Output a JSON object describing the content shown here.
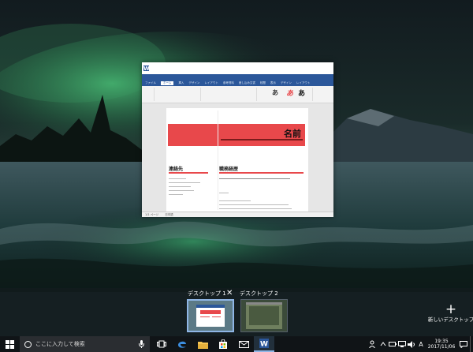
{
  "window": {
    "title": "文書 1 - Word",
    "app_icon_letter": "W",
    "ribbon_tabs": [
      "ファイル",
      "ホーム",
      "挿入",
      "デザイン",
      "レイアウト",
      "参考資料",
      "差し込み文書",
      "校閲",
      "表示",
      "デザイン",
      "レイアウト"
    ],
    "document": {
      "name_heading": "名前",
      "left_section_title": "連絡先",
      "right_section_title": "職務経歴",
      "status_left": "1/1 ページ",
      "status_right": "日本語"
    }
  },
  "taskview": {
    "desktop1_label": "デスクトップ 1",
    "desktop2_label": "デスクトップ 2",
    "close_symbol": "✕",
    "new_desktop_symbol": "+",
    "new_desktop_label": "新しいデスクトップ"
  },
  "taskbar": {
    "search_placeholder": "ここに入力して検索",
    "apps": [
      "task-view",
      "edge",
      "file-explorer",
      "store",
      "mail",
      "word"
    ],
    "clock_time": "19:35",
    "clock_date": "2017/11/06",
    "ime_indicator": "A"
  },
  "colors": {
    "word_blue": "#2b579a",
    "resume_red": "#e8484b",
    "taskbar": "#101417",
    "selection_border": "#8fb6e6"
  }
}
